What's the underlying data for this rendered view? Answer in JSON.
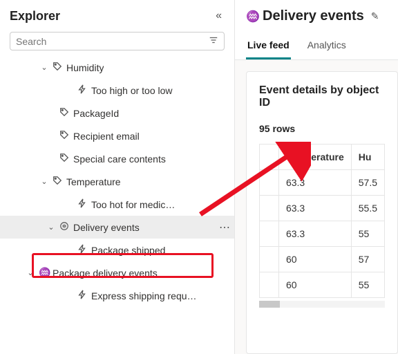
{
  "explorer": {
    "title": "Explorer",
    "search_placeholder": "Search",
    "items": {
      "humidity": "Humidity",
      "humidity_alert": "Too high or too low",
      "package_id": "PackageId",
      "recipient_email": "Recipient email",
      "special_care": "Special care contents",
      "temperature": "Temperature",
      "temp_alert": "Too hot for medic…",
      "delivery_events": "Delivery events",
      "package_shipped": "Package shipped",
      "package_delivery_events": "Package delivery events",
      "express_shipping": "Express shipping requ…"
    }
  },
  "right": {
    "title": "Delivery events",
    "tabs": {
      "live": "Live feed",
      "analytics": "Analytics"
    },
    "card_title": "Event details by object ID",
    "row_count": "95 rows",
    "columns": {
      "temperature": "Temperature",
      "humidity": "Hu"
    },
    "rows": [
      {
        "t": "63.3",
        "h": "57.5"
      },
      {
        "t": "63.3",
        "h": "55.5"
      },
      {
        "t": "63.3",
        "h": "55"
      },
      {
        "t": "60",
        "h": "57"
      },
      {
        "t": "60",
        "h": "55"
      }
    ]
  }
}
